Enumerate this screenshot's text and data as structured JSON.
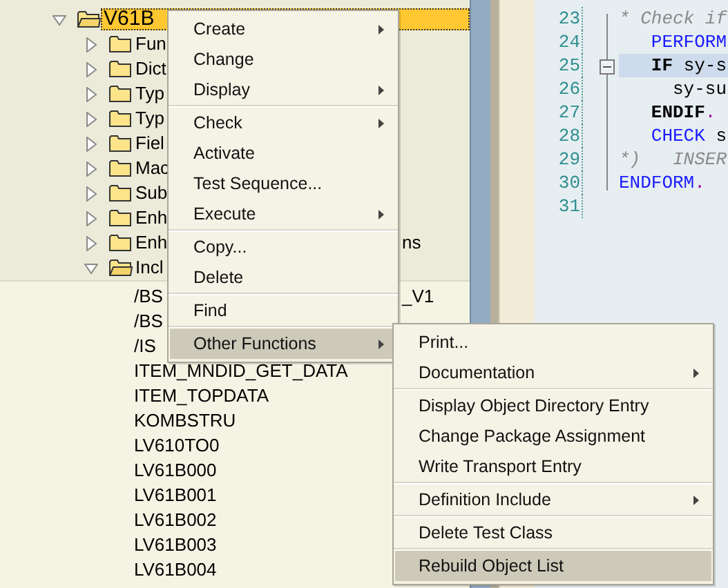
{
  "tree": {
    "label": "V61B",
    "expanded": true,
    "selected": true,
    "children": [
      {
        "label": "Fun",
        "expanded": false,
        "selected": false
      },
      {
        "label": "Dict",
        "expanded": false,
        "selected": false
      },
      {
        "label": "Typ",
        "expanded": false,
        "selected": false
      },
      {
        "label": "Typ",
        "expanded": false,
        "selected": false
      },
      {
        "label": "Fiel",
        "expanded": false,
        "selected": false
      },
      {
        "label": "Mac",
        "expanded": false,
        "selected": false
      },
      {
        "label": "Sub",
        "expanded": false,
        "selected": false
      },
      {
        "label": "Enh",
        "expanded": false,
        "selected": false
      },
      {
        "label": "Enh",
        "tail": "ns",
        "expanded": false,
        "selected": false
      },
      {
        "label": "Incl",
        "expanded": true,
        "selected": false,
        "children": [
          {
            "label": "/BS",
            "tail": "_V1",
            "selected": false
          },
          {
            "label": "/BS",
            "selected": false
          },
          {
            "label": "/IS",
            "selected": false
          },
          {
            "label": "ITEM_MNDID_GET_DATA",
            "selected": false
          },
          {
            "label": "ITEM_TOPDATA",
            "selected": false
          },
          {
            "label": "KOMBSTRU",
            "selected": false
          },
          {
            "label": "LV610TO0",
            "selected": false
          },
          {
            "label": "LV61B000",
            "selected": false
          },
          {
            "label": "LV61B001",
            "selected": false
          },
          {
            "label": "LV61B002",
            "selected": false
          },
          {
            "label": "LV61B003",
            "selected": false
          },
          {
            "label": "LV61B004",
            "selected": false
          }
        ]
      }
    ]
  },
  "editor": {
    "lines": [
      {
        "number": "23",
        "current": false,
        "tokens": [
          {
            "kind": "comment",
            "text": "* Check if"
          }
        ]
      },
      {
        "number": "24",
        "current": false,
        "tokens": [
          {
            "kind": "keyword",
            "text": "   PERFORM"
          }
        ]
      },
      {
        "number": "25",
        "current": true,
        "tokens": [
          {
            "kind": "statement",
            "text": "   IF"
          },
          {
            "kind": "text",
            "text": " sy-s"
          }
        ]
      },
      {
        "number": "26",
        "current": false,
        "tokens": [
          {
            "kind": "text",
            "text": "     sy-su"
          }
        ]
      },
      {
        "number": "27",
        "current": false,
        "tokens": [
          {
            "kind": "statement",
            "text": "   ENDIF"
          },
          {
            "kind": "punct",
            "text": "."
          }
        ]
      },
      {
        "number": "28",
        "current": false,
        "tokens": [
          {
            "kind": "keyword",
            "text": "   CHECK"
          },
          {
            "kind": "text",
            "text": " s"
          }
        ]
      },
      {
        "number": "29",
        "current": false,
        "tokens": [
          {
            "kind": "comment",
            "text": "*)   INSER"
          }
        ]
      },
      {
        "number": "30",
        "current": false,
        "tokens": [
          {
            "kind": "keyword",
            "text": "ENDFORM"
          },
          {
            "kind": "punct",
            "text": "."
          }
        ]
      },
      {
        "number": "31",
        "current": false
      }
    ]
  },
  "context_menu": {
    "groups": [
      [
        {
          "label": "Create",
          "submenu": true,
          "selected": false
        },
        {
          "label": "Change",
          "submenu": false,
          "selected": false
        },
        {
          "label": "Display",
          "submenu": true,
          "selected": false
        }
      ],
      [
        {
          "label": "Check",
          "submenu": true,
          "selected": false
        },
        {
          "label": "Activate",
          "submenu": false,
          "selected": false
        },
        {
          "label": "Test Sequence...",
          "submenu": false,
          "selected": false
        },
        {
          "label": "Execute",
          "submenu": true,
          "selected": false
        }
      ],
      [
        {
          "label": "Copy...",
          "submenu": false,
          "selected": false
        },
        {
          "label": "Delete",
          "submenu": false,
          "selected": false
        }
      ],
      [
        {
          "label": "Find",
          "submenu": false,
          "selected": false
        }
      ],
      [
        {
          "label": "Other Functions",
          "submenu": true,
          "selected": true
        }
      ]
    ]
  },
  "submenu": {
    "groups": [
      [
        {
          "label": "Print...",
          "submenu": false,
          "selected": false
        },
        {
          "label": "Documentation",
          "submenu": true,
          "selected": false
        }
      ],
      [
        {
          "label": "Display Object Directory Entry",
          "submenu": false,
          "selected": false
        },
        {
          "label": "Change Package Assignment",
          "submenu": false,
          "selected": false
        },
        {
          "label": "Write Transport Entry",
          "submenu": false,
          "selected": false
        }
      ],
      [
        {
          "label": "Definition Include",
          "submenu": true,
          "selected": false
        }
      ],
      [
        {
          "label": "Delete Test Class",
          "submenu": false,
          "selected": false
        }
      ],
      [
        {
          "label": "Rebuild Object List",
          "submenu": false,
          "selected": true
        }
      ]
    ]
  }
}
